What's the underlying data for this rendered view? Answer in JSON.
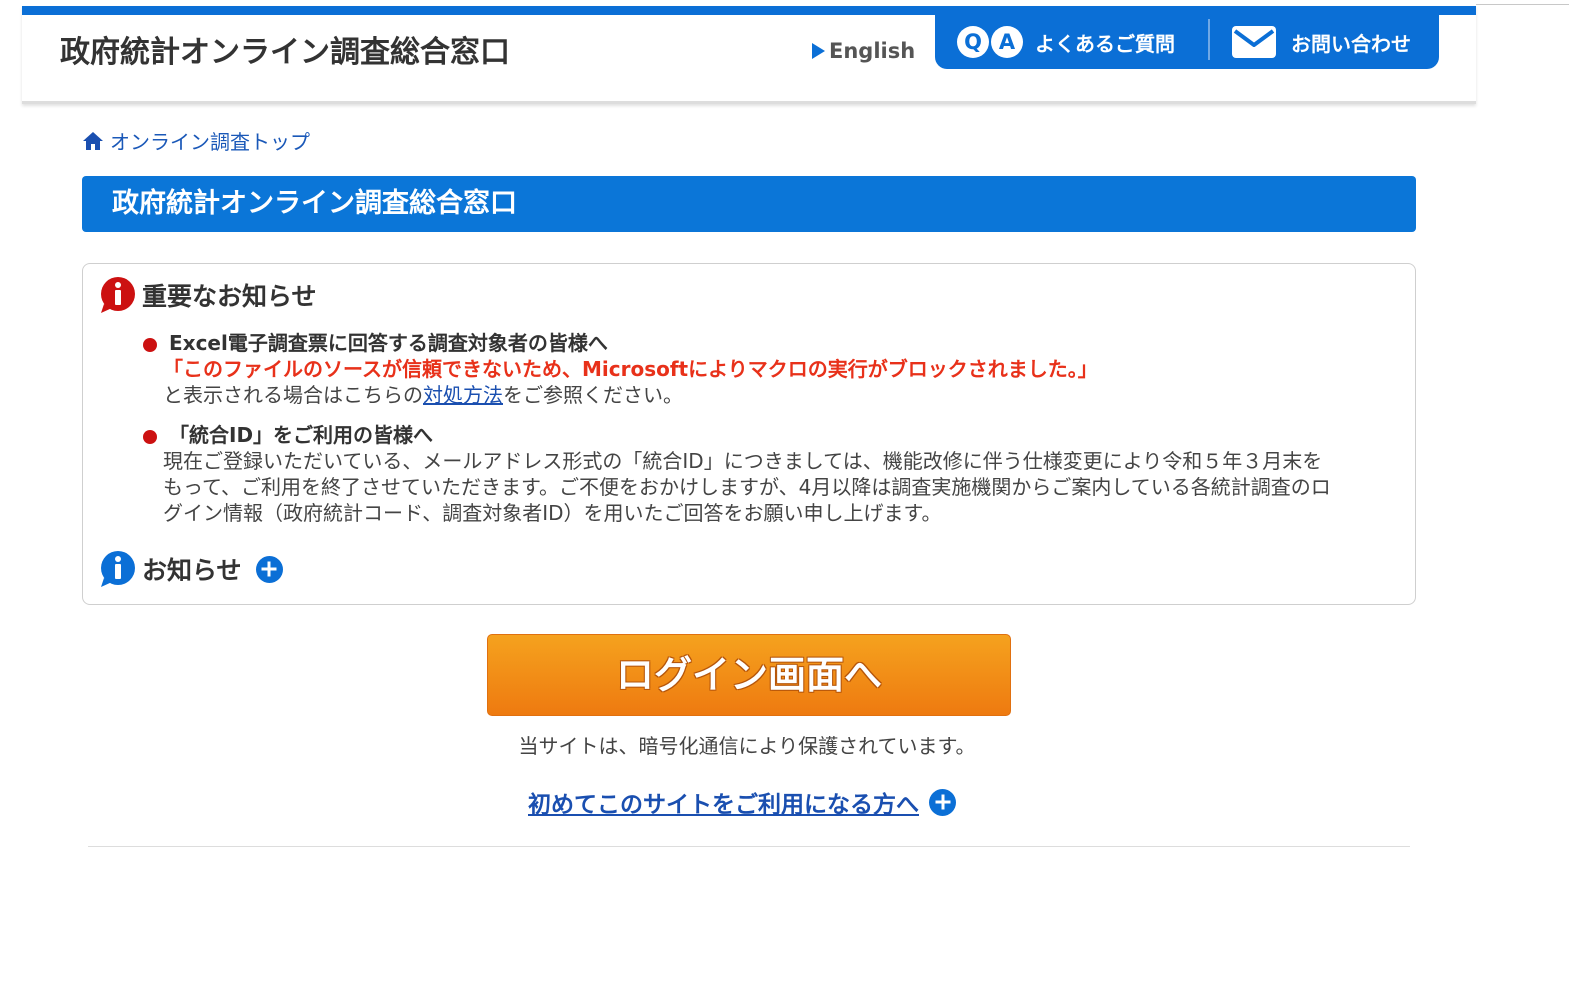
{
  "header": {
    "site_title": "政府統計オンライン調査総合窓口",
    "english_label": "English",
    "faq_label": "よくあるご質問",
    "faq_icon_letters": [
      "Q",
      "A"
    ],
    "contact_label": "お問い合わせ"
  },
  "breadcrumb": {
    "home_label": "オンライン調査トップ"
  },
  "page_title": "政府統計オンライン調査総合窓口",
  "important_notices": {
    "heading": "重要なお知らせ",
    "item1": {
      "title": "Excel電子調査票に回答する調査対象者の皆様へ",
      "red_text": "「このファイルのソースが信頼できないため、Microsoftによりマクロの実行がブロックされました。」",
      "text_before_link": "と表示される場合はこちらの",
      "link_text": "対処方法",
      "text_after_link": "をご参照ください。"
    },
    "item2": {
      "title": "「統合ID」をご利用の皆様へ",
      "body_line1": "現在ご登録いただいている、メールアドレス形式の「統合ID」につきましては、機能改修に伴う仕様変更により令和５年３月末を",
      "body_line2": "もって、ご利用を終了させていただきます。ご不便をおかけしますが、4月以降は調査実施機関からご案内している各統計調査のロ",
      "body_line3": "グイン情報（政府統計コード、調査対象者ID）を用いたご回答をお願い申し上げます。"
    }
  },
  "notices": {
    "heading": "お知らせ"
  },
  "login_button": "ログイン画面へ",
  "secure_note": "当サイトは、暗号化通信により保護されています。",
  "first_time_link": "初めてこのサイトをご利用になる方へ",
  "colors": {
    "primary_blue": "#0b6fd6",
    "alert_red": "#cc1111",
    "notice_red_text": "#e8311a",
    "login_orange": "#f08a15"
  }
}
